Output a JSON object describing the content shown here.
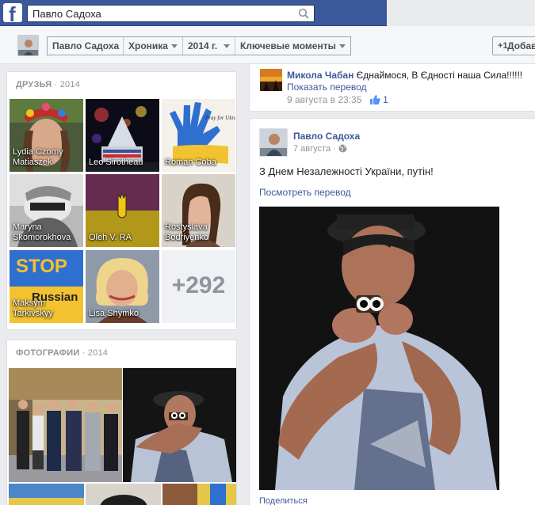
{
  "search": {
    "value": "Павло Садоха"
  },
  "nav": {
    "profile_name": "Павло Садоха",
    "timeline_label": "Хроника",
    "year_label": "2014 г.",
    "highlights_label": "Ключевые моменты",
    "add_label": "Добав"
  },
  "friends": {
    "title": "ДРУЗЬЯ",
    "year": "· 2014",
    "items": [
      {
        "name_line1": "Lydia Czorny",
        "name_line2": "Matiaszek"
      },
      {
        "name_line1": "Leo Sirotheau",
        "name_line2": ""
      },
      {
        "name_line1": "Roman Coba",
        "name_line2": ""
      },
      {
        "name_line1": "Maryna",
        "name_line2": "Skomorokhova"
      },
      {
        "name_line1": "Oleh V. RA",
        "name_line2": ""
      },
      {
        "name_line1": "Rostyslava",
        "name_line2": "Bodriyenko"
      },
      {
        "name_line1": "Maksym",
        "name_line2": "Tarkivskyy"
      },
      {
        "name_line1": "Lisa Shymko",
        "name_line2": ""
      }
    ],
    "more_count": "+292",
    "stop_text": "STOP",
    "russian_text": "Russian",
    "pray_text": "Pray for Ukraine"
  },
  "photos": {
    "title": "ФОТОГРАФИИ",
    "year": "· 2014"
  },
  "comment": {
    "author": "Микола Чабан",
    "text": "Єднаймося, В Єдності наша Сила!!!!!!",
    "translate": "Показать перевод",
    "date": "9 августа в 23:35",
    "likes": "1"
  },
  "post": {
    "author": "Павло Садоха",
    "date": "7 августа",
    "text": "З Днем Незалежності України, путін!",
    "translate": "Посмотреть перевод",
    "share": "Поделиться"
  },
  "colors": {
    "fb_blue": "#3b5998",
    "link": "#3b5998",
    "meta_gray": "#90949c"
  }
}
